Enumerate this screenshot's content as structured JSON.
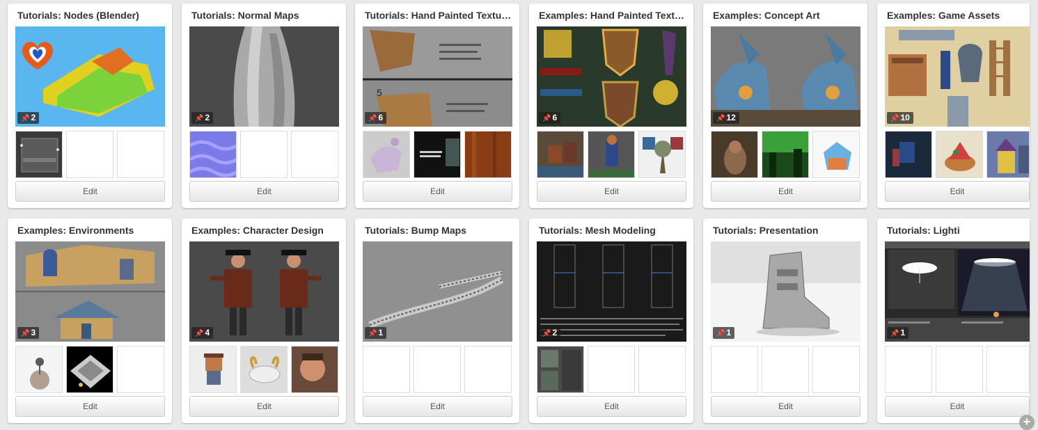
{
  "boards": [
    {
      "title": "Tutorials: Nodes (Blender)",
      "pins": "2",
      "edit_label": "Edit"
    },
    {
      "title": "Tutorials: Normal Maps",
      "pins": "2",
      "edit_label": "Edit"
    },
    {
      "title": "Tutorials: Hand Painted Textures",
      "pins": "6",
      "edit_label": "Edit"
    },
    {
      "title": "Examples: Hand Painted Textures",
      "pins": "6",
      "edit_label": "Edit"
    },
    {
      "title": "Examples: Concept Art",
      "pins": "12",
      "edit_label": "Edit"
    },
    {
      "title": "Examples: Game Assets",
      "pins": "10",
      "edit_label": "Edit"
    },
    {
      "title": "Examples: Environments",
      "pins": "3",
      "edit_label": "Edit"
    },
    {
      "title": "Examples: Character Design",
      "pins": "4",
      "edit_label": "Edit"
    },
    {
      "title": "Tutorials: Bump Maps",
      "pins": "1",
      "edit_label": "Edit"
    },
    {
      "title": "Tutorials: Mesh Modeling",
      "pins": "2",
      "edit_label": "Edit"
    },
    {
      "title": "Tutorials: Presentation",
      "pins": "1",
      "edit_label": "Edit"
    },
    {
      "title": "Tutorials: Lighti",
      "pins": "1",
      "edit_label": "Edit"
    }
  ],
  "icons": {
    "pin": "pin-icon",
    "add": "plus-icon"
  },
  "add_button_label": "+"
}
